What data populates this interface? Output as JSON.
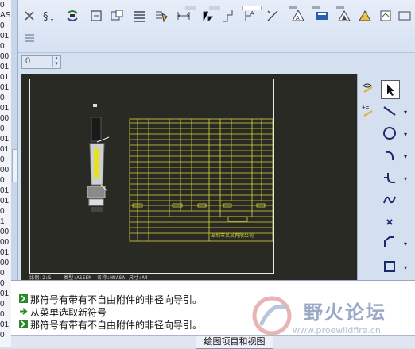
{
  "gutter": {
    "numbers": [
      "0",
      "AS",
      "0",
      "01",
      "0",
      "00",
      "01",
      "01",
      "01",
      "0",
      "01",
      "00",
      "0",
      "01",
      "01",
      "0",
      "00",
      "0",
      "01",
      "01",
      "0",
      "1",
      "00",
      "00",
      "01",
      "00",
      "0",
      "0",
      "01",
      "0",
      "0",
      "01",
      "0"
    ]
  },
  "toolbar": {
    "spinner_value": "0",
    "icons_row1": [
      "cancel-icon",
      "sort-icon",
      "regenerate-icon",
      "repaint-icon",
      "refit-icon",
      "table-icon",
      "flip-icon",
      "dimension-icon",
      "axis-icon",
      "datum-icon",
      "note-icon",
      "slash-icon",
      "text-style-icon",
      "view-icon",
      "triangle-icon",
      "sheet-icon",
      "import-icon"
    ],
    "icons_row2": [
      "layer-icon"
    ]
  },
  "drawing": {
    "scale_label": "比例:2:5",
    "type_label": "类型:ASSEM",
    "name_label": "名称:HUASA",
    "size_label": "尺寸:A4",
    "company_label": "深圳市某某有限公司"
  },
  "palette": {
    "tools": [
      "select-arrow",
      "hatch",
      "line",
      "circle",
      "arc",
      "fillet",
      "spline",
      "point",
      "chamfer",
      "rectangle"
    ]
  },
  "messages": [
    {
      "icon": "info-icon",
      "text": "那符号有带有不自由附件的非径向导引。"
    },
    {
      "icon": "arrow-icon",
      "text": "从菜单选取新符号"
    },
    {
      "icon": "info-icon",
      "text": "那符号有带有不自由附件的非径向导引。"
    }
  ],
  "status": {
    "button_label": "绘图项目和视图"
  },
  "watermark": {
    "title": "野火论坛",
    "url": "www.proewildfire.cn"
  },
  "colors": {
    "canvas": "#2a2a25",
    "table_lines": "#d9d63a",
    "toolbar": "#dbe5f4"
  }
}
